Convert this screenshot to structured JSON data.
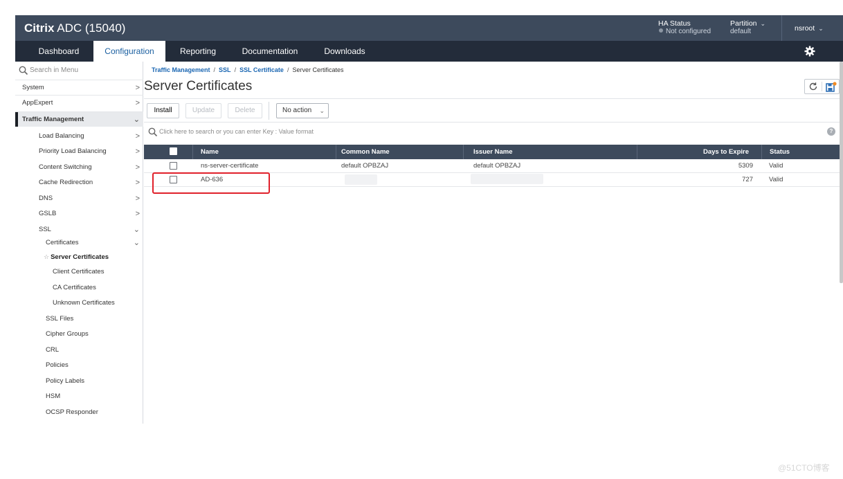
{
  "header": {
    "brand_bold": "Citrix",
    "brand_rest": " ADC (15040)",
    "ha_status_label": "HA Status",
    "ha_status_value": "Not configured",
    "partition_label": "Partition",
    "partition_value": "default",
    "user": "nsroot"
  },
  "nav": {
    "tabs": [
      {
        "label": "Dashboard"
      },
      {
        "label": "Configuration"
      },
      {
        "label": "Reporting"
      },
      {
        "label": "Documentation"
      },
      {
        "label": "Downloads"
      }
    ],
    "active": "Configuration"
  },
  "sidebar": {
    "search_placeholder": "Search in Menu",
    "items": [
      {
        "label": "System"
      },
      {
        "label": "AppExpert"
      },
      {
        "label": "Traffic Management"
      },
      {
        "label": "Load Balancing"
      },
      {
        "label": "Priority Load Balancing"
      },
      {
        "label": "Content Switching"
      },
      {
        "label": "Cache Redirection"
      },
      {
        "label": "DNS"
      },
      {
        "label": "GSLB"
      },
      {
        "label": "SSL"
      },
      {
        "label": "Certificates"
      },
      {
        "label": "Server Certificates"
      },
      {
        "label": "Client Certificates"
      },
      {
        "label": "CA Certificates"
      },
      {
        "label": "Unknown Certificates"
      },
      {
        "label": "SSL Files"
      },
      {
        "label": "Cipher Groups"
      },
      {
        "label": "CRL"
      },
      {
        "label": "Policies"
      },
      {
        "label": "Policy Labels"
      },
      {
        "label": "HSM"
      },
      {
        "label": "OCSP Responder"
      }
    ]
  },
  "breadcrumb": {
    "items": [
      "Traffic Management",
      "SSL",
      "SSL Certificate",
      "Server Certificates"
    ],
    "separator": "/"
  },
  "page": {
    "title": "Server Certificates"
  },
  "toolbar": {
    "install": "Install",
    "update": "Update",
    "delete": "Delete",
    "action_select": "No action"
  },
  "table": {
    "search_placeholder": "Click here to search or you can enter Key : Value format",
    "help": "?",
    "columns": [
      "Name",
      "Common Name",
      "Issuer Name",
      "Days to Expire",
      "Status"
    ],
    "rows": [
      {
        "name": "ns-server-certificate",
        "common_name": "default OPBZAJ",
        "issuer_name": "default OPBZAJ",
        "days_to_expire": "5309",
        "status": "Valid"
      },
      {
        "name": "AD-636",
        "common_name": "",
        "issuer_name": "",
        "days_to_expire": "727",
        "status": "Valid"
      }
    ]
  },
  "watermark": "@51CTO博客",
  "colors": {
    "header_bg": "#3d4a5c",
    "nav_bg": "#232c3a",
    "link": "#1a66b2",
    "highlight": "#e0202a"
  }
}
